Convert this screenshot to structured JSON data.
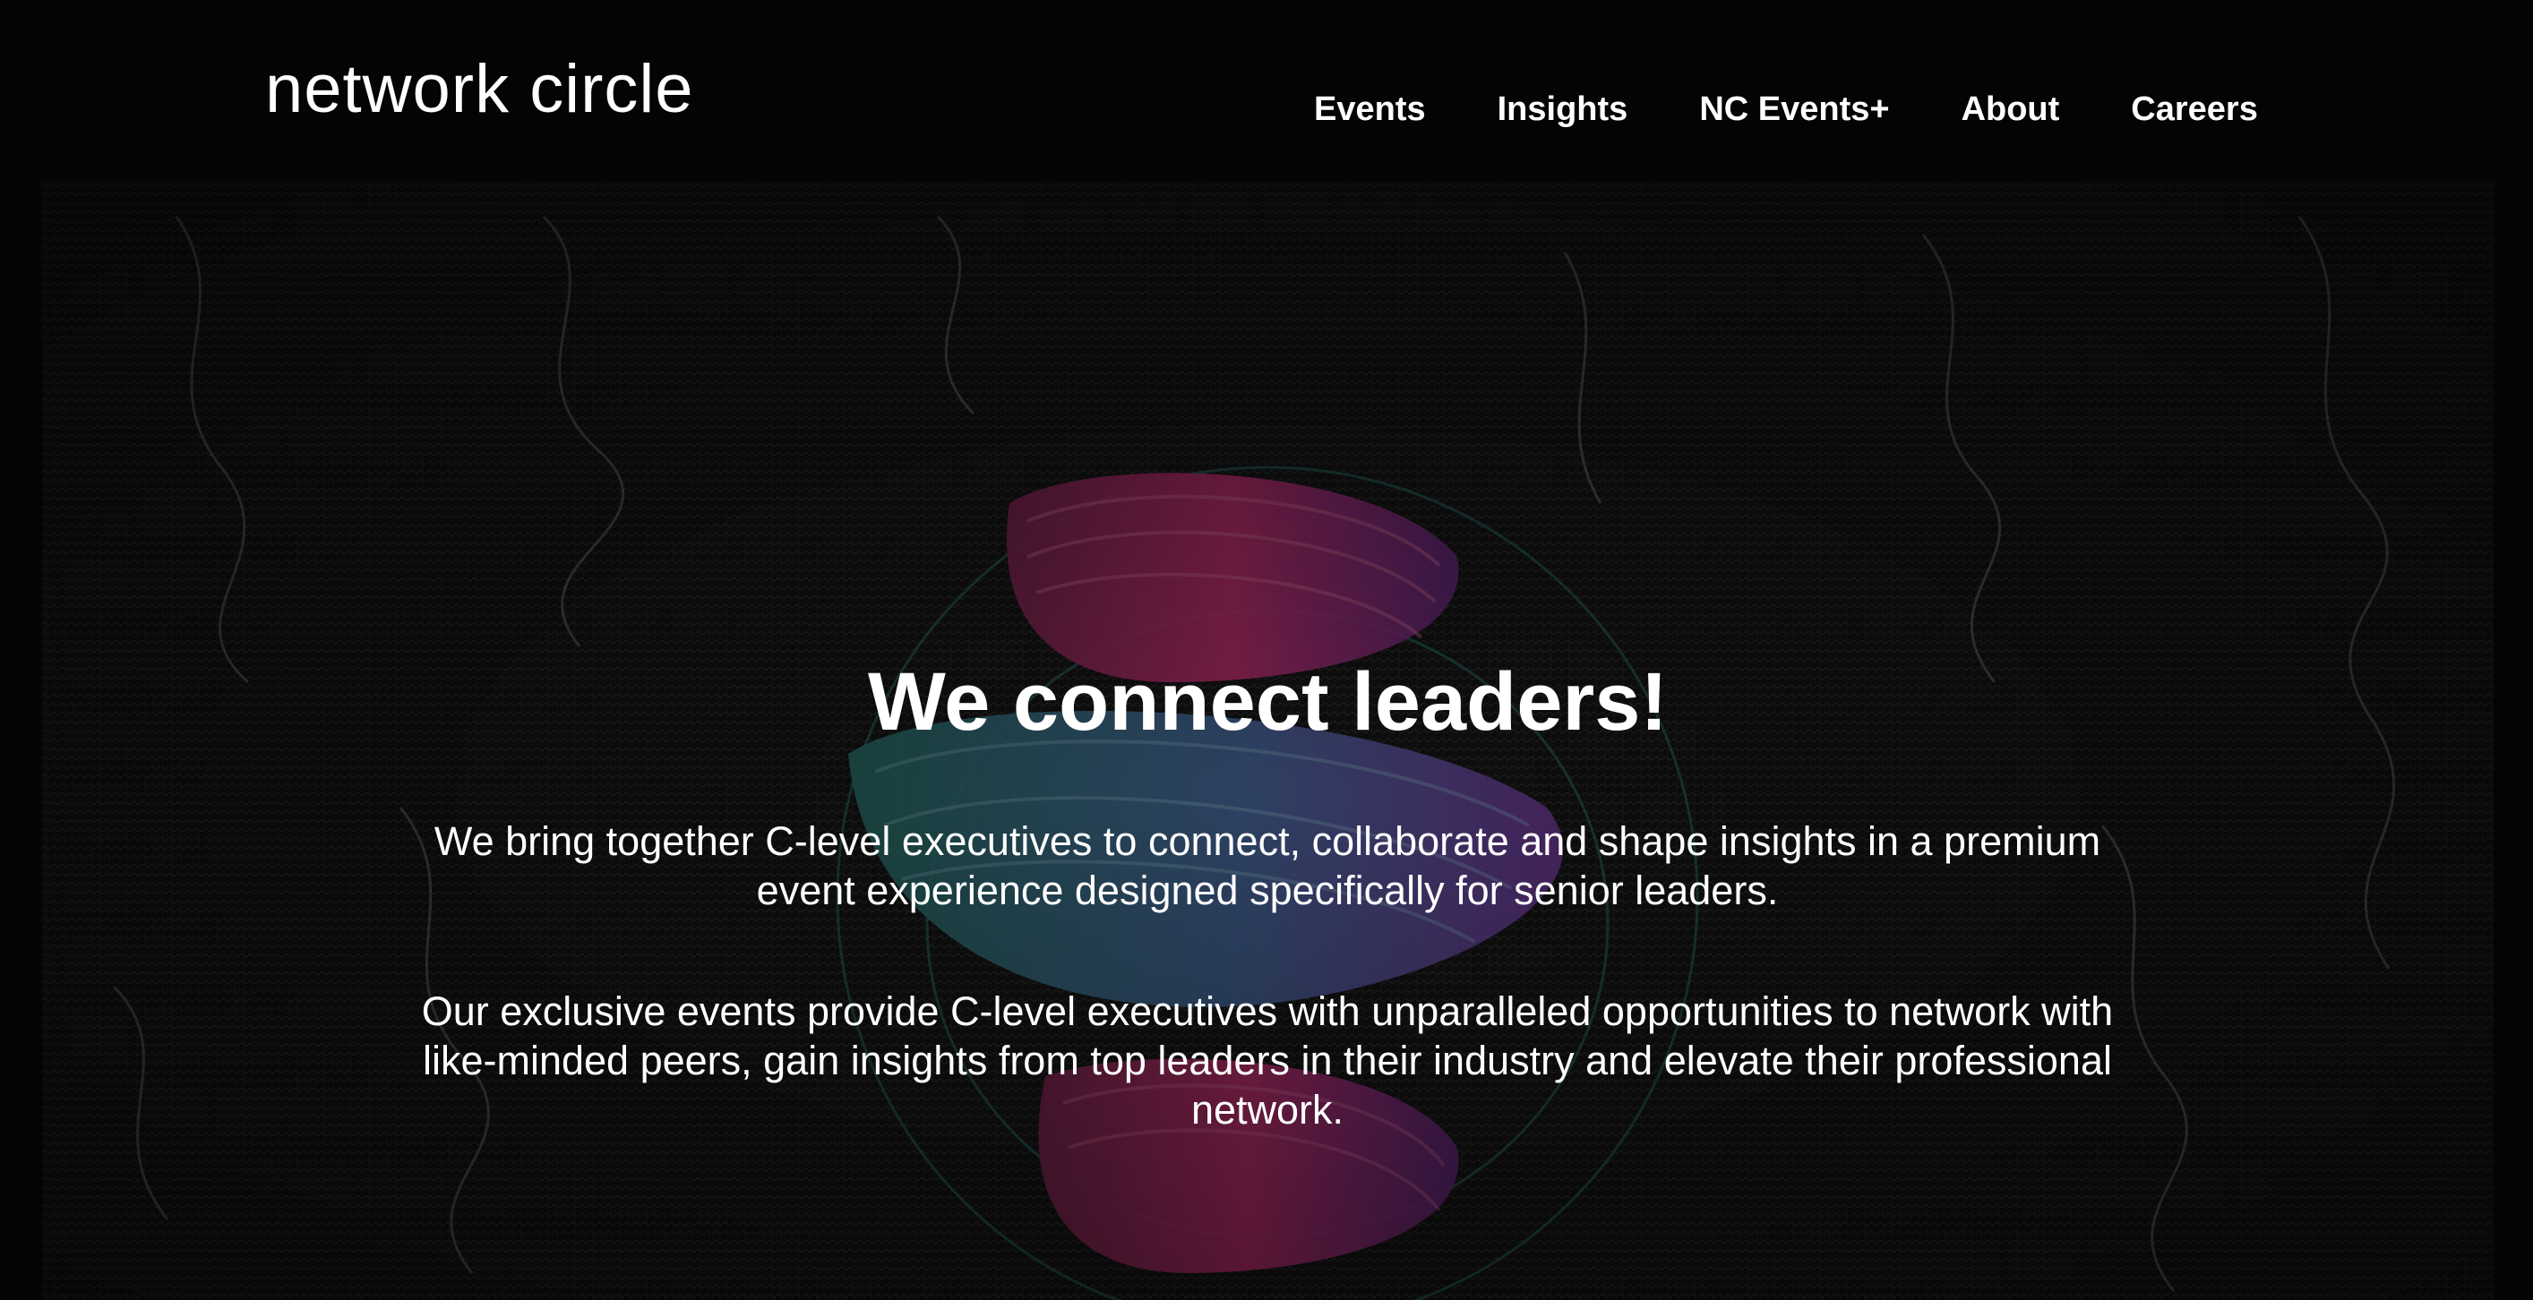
{
  "header": {
    "logo": "network circle",
    "nav": [
      {
        "label": "Events"
      },
      {
        "label": "Insights"
      },
      {
        "label": "NC Events+"
      },
      {
        "label": "About"
      },
      {
        "label": "Careers"
      }
    ]
  },
  "hero": {
    "title": "We connect leaders!",
    "paragraph1": "We bring together C-level executives to connect, collaborate and shape insights in a premium event experience designed specifically for senior leaders.",
    "paragraph2": "Our exclusive events provide C-level executives with unparalleled opportunities to network with like-minded peers, gain insights from top leaders in their industry and elevate their professional network."
  },
  "colors": {
    "background": "#040404",
    "text": "#ffffff",
    "accent_pink": "#c2306f",
    "accent_teal": "#2f7a74",
    "accent_purple": "#6a3f9a"
  }
}
